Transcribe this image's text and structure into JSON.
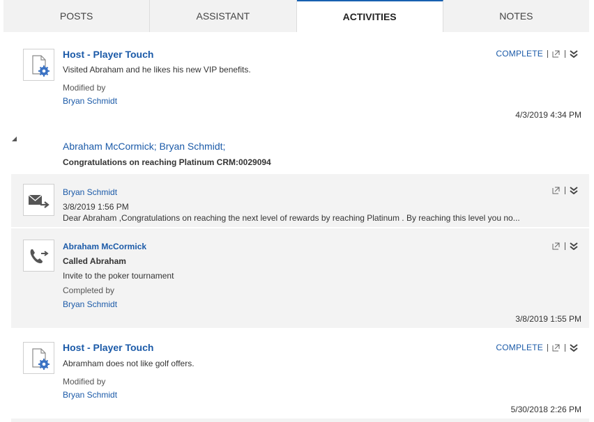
{
  "tabs": [
    {
      "label": "POSTS"
    },
    {
      "label": "ASSISTANT"
    },
    {
      "label": "ACTIVITIES"
    },
    {
      "label": "NOTES"
    }
  ],
  "activities": [
    {
      "title": "Host - Player Touch",
      "description": "Visited Abraham and he likes his new VIP benefits.",
      "modified_label": "Modified by",
      "modified_by": "Bryan Schmidt",
      "action": "COMPLETE",
      "timestamp": "4/3/2019 4:34 PM",
      "icon": "task-gear-icon"
    },
    {
      "title": "Host - Player Touch",
      "description": "Abramham does not like golf offers.",
      "modified_label": "Modified by",
      "modified_by": "Bryan Schmidt",
      "action": "COMPLETE",
      "timestamp": "5/30/2018 2:26 PM",
      "icon": "task-gear-icon"
    }
  ],
  "group": {
    "title": "Abraham McCormick; Bryan Schmidt;",
    "subject": "Congratulations on reaching Platinum CRM:0029094",
    "email": {
      "sender": "Bryan Schmidt",
      "date": "3/8/2019 1:56 PM",
      "preview": "Dear Abraham ,Congratulations on reaching the next level of rewards by reaching Platinum .  By reaching this level you no...",
      "icon": "email-icon"
    },
    "call": {
      "contact": "Abraham McCormick",
      "subject": "Called Abraham",
      "description": "Invite to the poker tournament",
      "completed_label": "Completed by",
      "completed_by": "Bryan Schmidt",
      "timestamp": "3/8/2019 1:55 PM",
      "icon": "phone-call-icon"
    }
  }
}
